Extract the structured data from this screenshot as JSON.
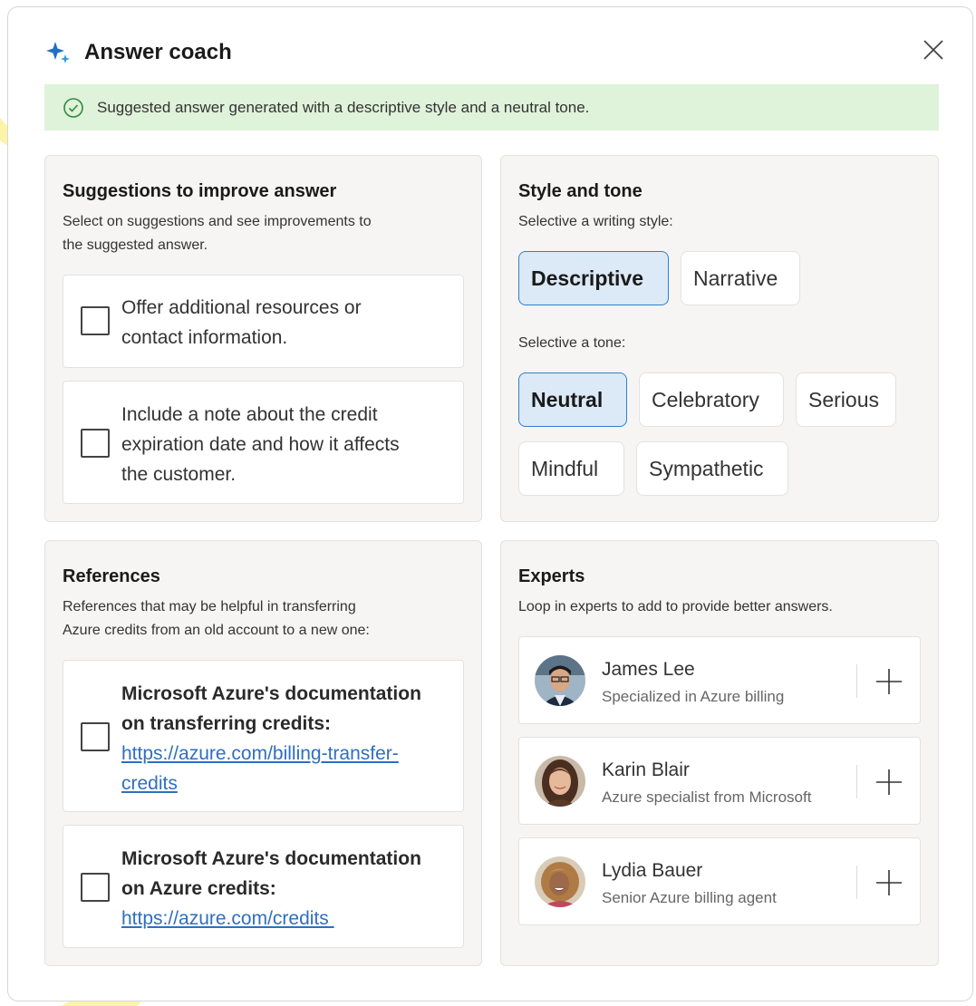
{
  "header": {
    "title": "Answer coach"
  },
  "banner": {
    "text": "Suggested answer generated with a descriptive style and a neutral tone."
  },
  "suggestions": {
    "title": "Suggestions to improve answer",
    "description_line1": "Select on suggestions and see improvements to",
    "description_line2": "the suggested answer.",
    "items": [
      {
        "lines": [
          "Offer additional resources or",
          "contact information."
        ]
      },
      {
        "lines": [
          "Include a note about the credit",
          "expiration date and how it affects",
          "the customer."
        ]
      }
    ]
  },
  "style_tone": {
    "title": "Style and tone",
    "style_label": "Selective a writing style:",
    "styles": [
      "Descriptive",
      "Narrative"
    ],
    "selected_style": "Descriptive",
    "tone_label": "Selective a tone:",
    "tones": [
      "Neutral",
      "Celebratory",
      "Serious",
      "Mindful",
      "Sympathetic"
    ],
    "selected_tone": "Neutral"
  },
  "references": {
    "title": "References",
    "description_line1": "References that may be helpful in transferring",
    "description_line2": "Azure credits from an old account to a new one:",
    "items": [
      {
        "title_lines": [
          "Microsoft Azure's documentation",
          "on transferring credits:"
        ],
        "link_lines": [
          "https://azure.com/billing-transfer-",
          "credits"
        ]
      },
      {
        "title_lines": [
          "Microsoft Azure's documentation",
          "on Azure credits:"
        ],
        "link_lines": [
          "https://azure.com/credits "
        ]
      }
    ]
  },
  "experts": {
    "title": "Experts",
    "description": "Loop in experts to add to provide better answers.",
    "people": [
      {
        "name": "James Lee",
        "role": "Specialized in Azure billing"
      },
      {
        "name": "Karin Blair",
        "role": "Azure specialist from Microsoft"
      },
      {
        "name": "Lydia Bauer",
        "role": "Senior Azure billing agent"
      }
    ]
  },
  "colors": {
    "accent": "#2f7fd0",
    "selected_chip_bg": "#dce9f6",
    "banner_bg": "#dff2da",
    "success": "#2e8b3e",
    "link": "#2f6fbf",
    "callout": "#fbf4a8"
  }
}
